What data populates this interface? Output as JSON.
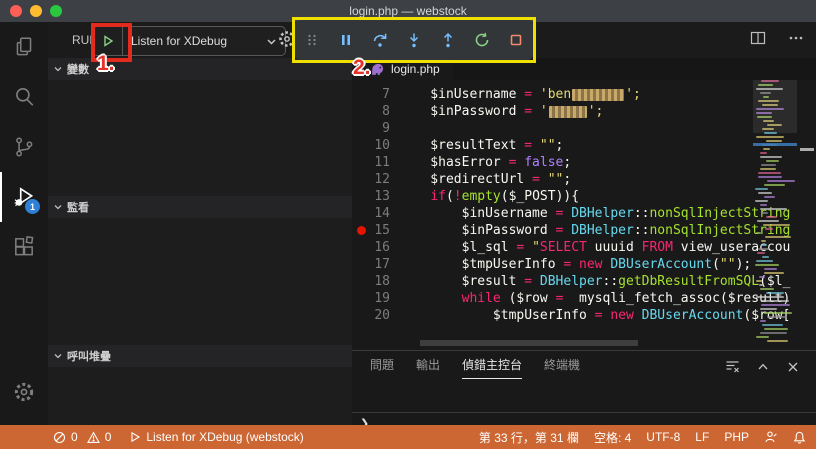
{
  "window": {
    "title": "login.php — webstock"
  },
  "colors": {
    "statusbar": "#cc6633",
    "toolbar_blue": "#75beff",
    "toolbar_green": "#89d185",
    "toolbar_red": "#f48771",
    "breakpoint": "#e51400",
    "badge": "#2f7fd6",
    "annotation_red": "#e63329",
    "box_red": "#e22b1d",
    "box_yellow": "#f0e000",
    "php_purple": "#9d6fd0",
    "code_v": "#f8f8f2",
    "code_o": "#f92672",
    "code_s": "#e6db74",
    "code_k": "#f92672",
    "code_k2": "#ae81ff",
    "code_f": "#a6e22e",
    "code_t": "#66d9ef"
  },
  "activity_bar": {
    "items": [
      "explorer",
      "search",
      "source-control",
      "run-and-debug",
      "extensions",
      "settings"
    ],
    "active_item": "run-and-debug",
    "badge": "1"
  },
  "run_bar": {
    "run_label": "RUN",
    "config_name": "Listen for XDebug"
  },
  "debug_toolbar": {
    "icons": [
      "drag-grip",
      "pause",
      "step-over",
      "step-into",
      "step-out",
      "restart",
      "stop"
    ]
  },
  "annotations": {
    "step1": "1.",
    "step2": "2."
  },
  "sidebar": {
    "sections": [
      {
        "label": "變數"
      },
      {
        "label": "監看"
      },
      {
        "label": "呼叫堆疊"
      }
    ]
  },
  "editor": {
    "tab": {
      "label": "login.php",
      "icon": "php-elephant-icon"
    },
    "breakpoint_line": 15,
    "lines": [
      {
        "num": 7,
        "tokens": [
          {
            "t": "    $inUsername ",
            "c": "v"
          },
          {
            "t": "= ",
            "c": "o"
          },
          {
            "t": "'ben",
            "c": "s"
          },
          {
            "t": "",
            "c": "censor",
            "w": 52
          },
          {
            "t": "';",
            "c": "s"
          }
        ]
      },
      {
        "num": 8,
        "tokens": [
          {
            "t": "    $inPassword ",
            "c": "v"
          },
          {
            "t": "= ",
            "c": "o"
          },
          {
            "t": "'",
            "c": "s"
          },
          {
            "t": "",
            "c": "censor",
            "w": 38
          },
          {
            "t": "';",
            "c": "s"
          }
        ]
      },
      {
        "num": 9,
        "tokens": []
      },
      {
        "num": 10,
        "tokens": [
          {
            "t": "    $resultText ",
            "c": "v"
          },
          {
            "t": "= ",
            "c": "o"
          },
          {
            "t": "\"\"",
            "c": "s"
          },
          {
            "t": ";",
            "c": "v"
          }
        ]
      },
      {
        "num": 11,
        "tokens": [
          {
            "t": "    $hasError ",
            "c": "v"
          },
          {
            "t": "= ",
            "c": "o"
          },
          {
            "t": "false",
            "c": "k2"
          },
          {
            "t": ";",
            "c": "v"
          }
        ]
      },
      {
        "num": 12,
        "tokens": [
          {
            "t": "    $redirectUrl ",
            "c": "v"
          },
          {
            "t": "= ",
            "c": "o"
          },
          {
            "t": "\"\"",
            "c": "s"
          },
          {
            "t": ";",
            "c": "v"
          }
        ]
      },
      {
        "num": 13,
        "tokens": [
          {
            "t": "    ",
            "c": "v"
          },
          {
            "t": "if",
            "c": "k"
          },
          {
            "t": "(",
            "c": "v"
          },
          {
            "t": "!",
            "c": "o"
          },
          {
            "t": "empty",
            "c": "f"
          },
          {
            "t": "(",
            "c": "v"
          },
          {
            "t": "$_POST",
            "c": "v"
          },
          {
            "t": ")){",
            "c": "v"
          }
        ]
      },
      {
        "num": 14,
        "tokens": [
          {
            "t": "        $inUsername ",
            "c": "v"
          },
          {
            "t": "= ",
            "c": "o"
          },
          {
            "t": "DBHelper",
            "c": "t"
          },
          {
            "t": "::",
            "c": "v"
          },
          {
            "t": "nonSqlInjectString",
            "c": "f"
          }
        ]
      },
      {
        "num": 15,
        "tokens": [
          {
            "t": "        $inPassword ",
            "c": "v"
          },
          {
            "t": "= ",
            "c": "o"
          },
          {
            "t": "DBHelper",
            "c": "t"
          },
          {
            "t": "::",
            "c": "v"
          },
          {
            "t": "nonSqlInjectString",
            "c": "f"
          }
        ]
      },
      {
        "num": 16,
        "tokens": [
          {
            "t": "        $l_sql ",
            "c": "v"
          },
          {
            "t": "= ",
            "c": "o"
          },
          {
            "t": "\"",
            "c": "s"
          },
          {
            "t": "SELECT",
            "c": "k"
          },
          {
            "t": " uuuid ",
            "c": "v"
          },
          {
            "t": "FROM",
            "c": "k"
          },
          {
            "t": " view_useraccou",
            "c": "v"
          }
        ]
      },
      {
        "num": 17,
        "tokens": [
          {
            "t": "        $tmpUserInfo ",
            "c": "v"
          },
          {
            "t": "= ",
            "c": "o"
          },
          {
            "t": "new ",
            "c": "k"
          },
          {
            "t": "DBUserAccount",
            "c": "t"
          },
          {
            "t": "(",
            "c": "v"
          },
          {
            "t": "\"\"",
            "c": "s"
          },
          {
            "t": ");",
            "c": "v"
          }
        ]
      },
      {
        "num": 18,
        "tokens": [
          {
            "t": "        $result ",
            "c": "v"
          },
          {
            "t": "= ",
            "c": "o"
          },
          {
            "t": "DBHelper",
            "c": "t"
          },
          {
            "t": "::",
            "c": "v"
          },
          {
            "t": "getDbResultFromSQL",
            "c": "f"
          },
          {
            "t": "($l_",
            "c": "v"
          }
        ]
      },
      {
        "num": 19,
        "tokens": [
          {
            "t": "        ",
            "c": "v"
          },
          {
            "t": "while ",
            "c": "k"
          },
          {
            "t": "($row ",
            "c": "v"
          },
          {
            "t": "= ",
            "c": "o"
          },
          {
            "t": " mysqli_fetch_assoc",
            "c": "v"
          },
          {
            "t": "($result)",
            "c": "v"
          }
        ]
      },
      {
        "num": 20,
        "tokens": [
          {
            "t": "            $tmpUserInfo ",
            "c": "v"
          },
          {
            "t": "= ",
            "c": "o"
          },
          {
            "t": "new ",
            "c": "k"
          },
          {
            "t": "DBUserAccount",
            "c": "t"
          },
          {
            "t": "($row[",
            "c": "v"
          }
        ]
      }
    ]
  },
  "panel": {
    "tabs": [
      {
        "label": "問題",
        "active": false
      },
      {
        "label": "輸出",
        "active": false
      },
      {
        "label": "偵錯主控台",
        "active": true
      },
      {
        "label": "終端機",
        "active": false
      }
    ],
    "action_icons": [
      "clear-console",
      "maximize-panel",
      "close-panel"
    ],
    "prompt": "❯"
  },
  "status_bar": {
    "errors": "0",
    "warnings": "0",
    "debug_status": "Listen for XDebug (webstock)",
    "cursor": "第 33 行，第 31 欄",
    "indent": "空格: 4",
    "encoding": "UTF-8",
    "eol": "LF",
    "language": "PHP",
    "icons": [
      "error-circle",
      "warning-triangle",
      "play-outline",
      "feedback",
      "bell"
    ]
  }
}
